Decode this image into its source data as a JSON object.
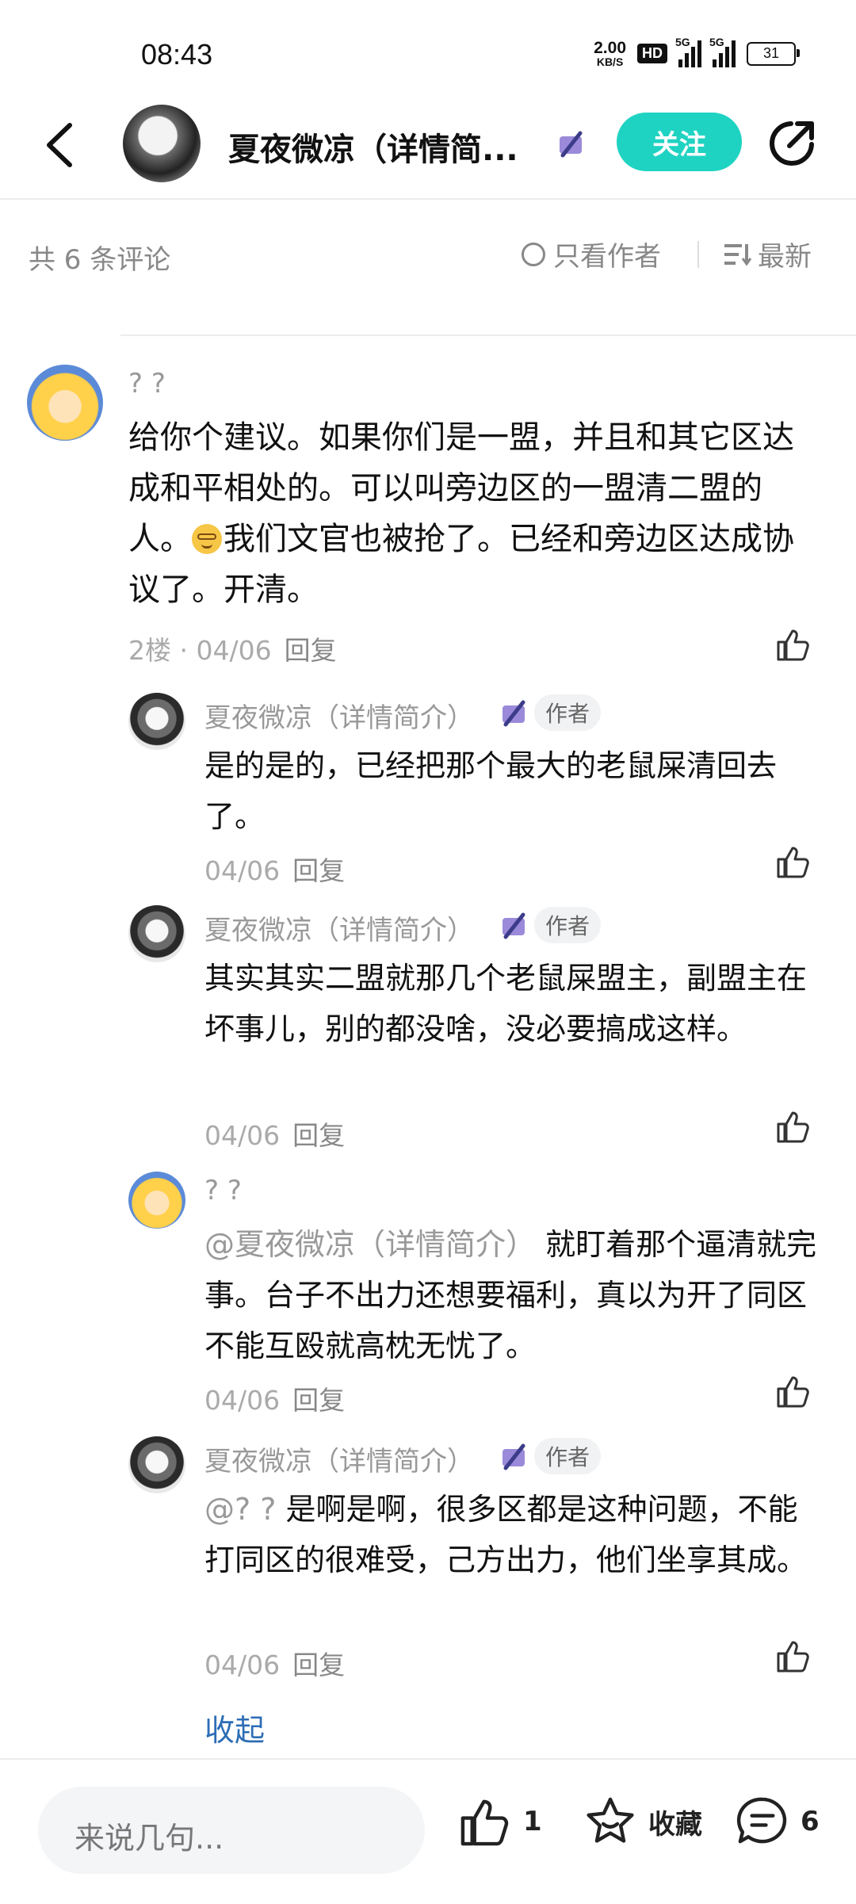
{
  "status_bar": {
    "time": "08:43",
    "net_speed": "2.00",
    "net_unit": "KB/S",
    "hd": "HD",
    "sig1": "5G",
    "sig2": "5G",
    "battery": "31"
  },
  "nav": {
    "title": "夏夜微凉（详情简...",
    "follow_label": "关注"
  },
  "filter": {
    "count_label": "共 6 条评论",
    "only_author_label": "只看作者",
    "sort_label": "最新"
  },
  "comments": {
    "main": {
      "name": "? ?",
      "text_part1": "给你个建议。如果你们是一盟，并且和其它区达成和平相处的。可以叫旁边区的一盟清二盟的人。",
      "text_part2": "我们文官也被抢了。已经和旁边区达成协议了。开清。",
      "floor": "2楼 · 04/06",
      "reply": "回复"
    },
    "replies": [
      {
        "name": "夏夜微凉（详情简介）",
        "tag": "作者",
        "mention": "",
        "text": "是的是的，已经把那个最大的老鼠屎清回去了。",
        "date": "04/06",
        "reply": "回复"
      },
      {
        "name": "夏夜微凉（详情简介）",
        "tag": "作者",
        "mention": "",
        "text": "其实其实二盟就那几个老鼠屎盟主，副盟主在坏事儿，别的都没啥，没必要搞成这样。",
        "date": "04/06",
        "reply": "回复"
      },
      {
        "name": "? ?",
        "tag": "",
        "mention": "@夏夜微凉（详情简介） ",
        "text": "就盯着那个逼清就完事。台子不出力还想要福利，真以为开了同区不能互殴就高枕无忧了。",
        "date": "04/06",
        "reply": "回复"
      },
      {
        "name": "夏夜微凉（详情简介）",
        "tag": "作者",
        "mention": "@? ? ",
        "text": "是啊是啊，很多区都是这种问题，不能打同区的很难受，己方出力，他们坐享其成。",
        "date": "04/06",
        "reply": "回复"
      }
    ],
    "collapse_label": "收起"
  },
  "bottom": {
    "placeholder": "来说几句...",
    "like_count": "1",
    "fav_label": "收藏",
    "comment_count": "6"
  }
}
